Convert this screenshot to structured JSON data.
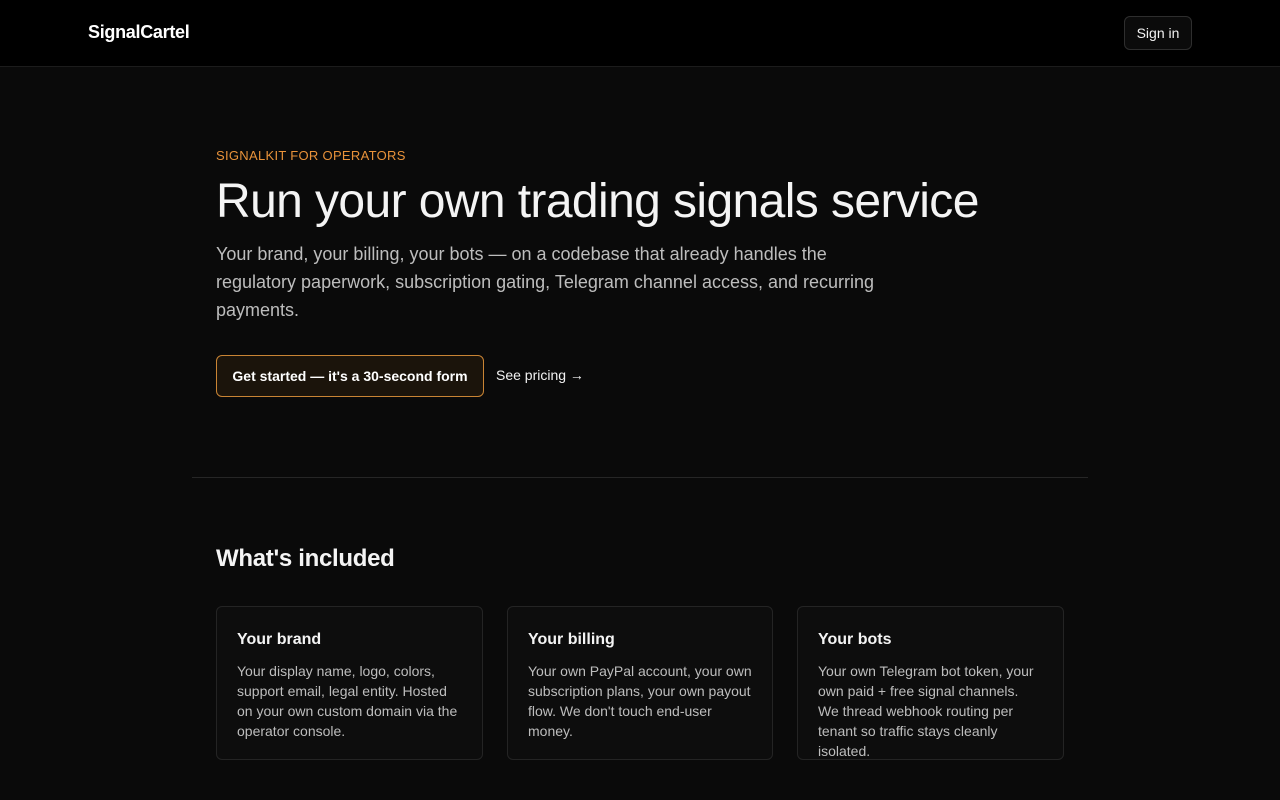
{
  "header": {
    "brand": "SignalCartel",
    "signin_label": "Sign in"
  },
  "hero": {
    "eyebrow": "SIGNALKIT FOR OPERATORS",
    "title": "Run your own trading signals service",
    "subtitle": "Your brand, your billing, your bots — on a codebase that already handles the regulatory paperwork, subscription gating, Telegram channel access, and recurring payments.",
    "cta_label": "Get started — it's a 30-second form",
    "pricing_label": "See pricing →"
  },
  "included": {
    "title": "What's included",
    "cards": [
      {
        "title": "Your brand",
        "body": "Your display name, logo, colors, support email, legal entity. Hosted on your own custom domain via the operator console."
      },
      {
        "title": "Your billing",
        "body": "Your own PayPal account, your own subscription plans, your own payout flow. We don't touch end-user money."
      },
      {
        "title": "Your bots",
        "body": "Your own Telegram bot token, your own paid + free signal channels. We thread webhook routing per tenant so traffic stays cleanly isolated."
      }
    ]
  },
  "colors": {
    "accent": "#e8923a",
    "background": "#0a0a0a",
    "header_background": "#000000"
  }
}
